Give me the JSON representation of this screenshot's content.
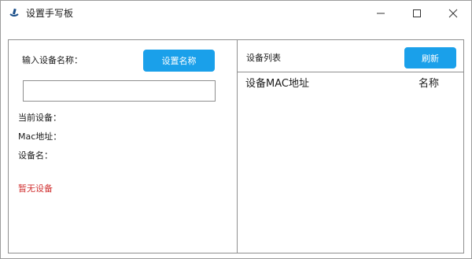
{
  "window": {
    "title": "设置手写板"
  },
  "left": {
    "name_label": "输入设备名称：",
    "set_name_button": "设置名称",
    "name_input_value": "",
    "current_device_label": "当前设备：",
    "mac_label": "Mac地址：",
    "device_name_label": "设备名：",
    "status_text": "暂无设备"
  },
  "right": {
    "list_title": "设备列表",
    "refresh_button": "刷新",
    "columns": [
      "设备MAC地址",
      "名称"
    ]
  },
  "colors": {
    "accent": "#1aa0ea",
    "error": "#d03030"
  }
}
